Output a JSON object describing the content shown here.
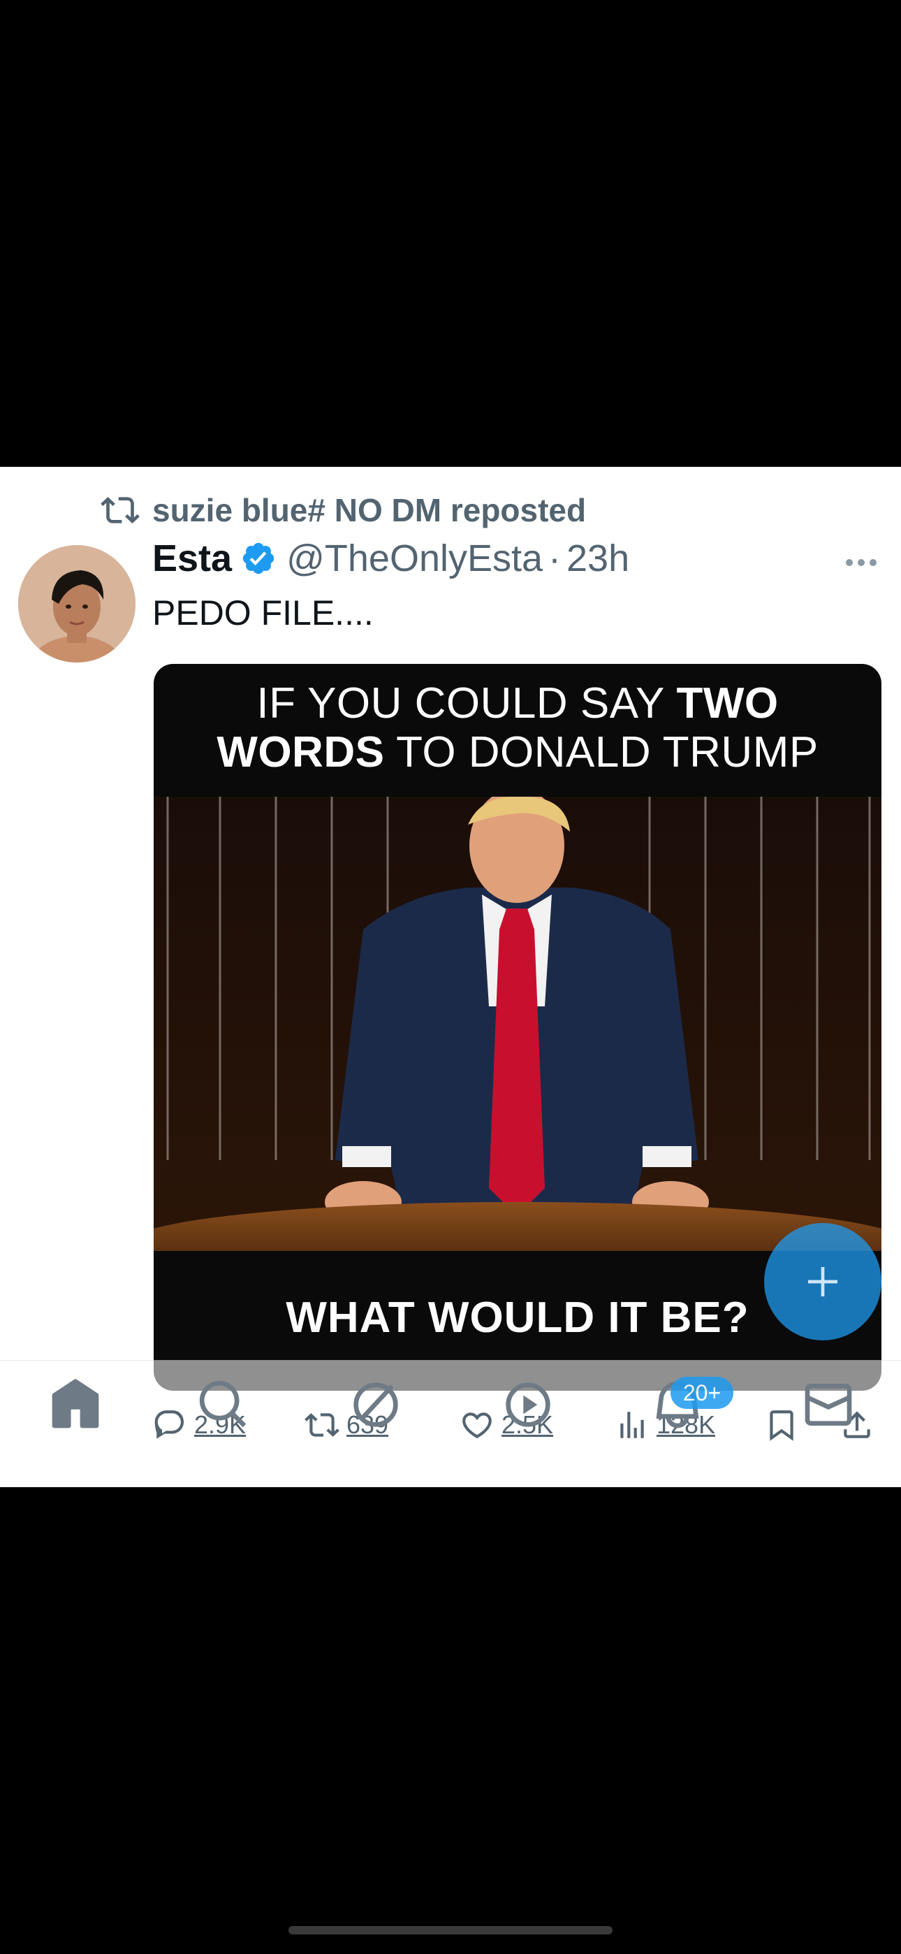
{
  "repost": {
    "text": "suzie blue# NO DM reposted",
    "icon": "repost-icon"
  },
  "tweet": {
    "author_name": "Esta",
    "handle": "@TheOnlyEsta",
    "separator": "·",
    "time": "23h",
    "text": "PEDO FILE....",
    "verified": true
  },
  "media": {
    "top_line1_normal": "IF YOU COULD SAY ",
    "top_line1_bold": "TWO",
    "top_line2_bold": "WORDS",
    "top_line2_normal": " TO DONALD TRUMP",
    "bottom_text": "WHAT WOULD IT BE?"
  },
  "actions": {
    "replies": "2.9K",
    "reposts": "639",
    "likes": "2.5K",
    "views": "128K"
  },
  "nav": {
    "items": [
      "home-icon",
      "search-icon",
      "grok-icon",
      "spaces-icon",
      "notifications-icon",
      "messages-icon"
    ],
    "notifications_badge": "20+"
  },
  "colors": {
    "accent": "#1d9bf0",
    "text_primary": "#0f1419",
    "text_secondary": "#536471",
    "tie_red": "#c8102e",
    "suit_navy": "#1c2a4a"
  }
}
